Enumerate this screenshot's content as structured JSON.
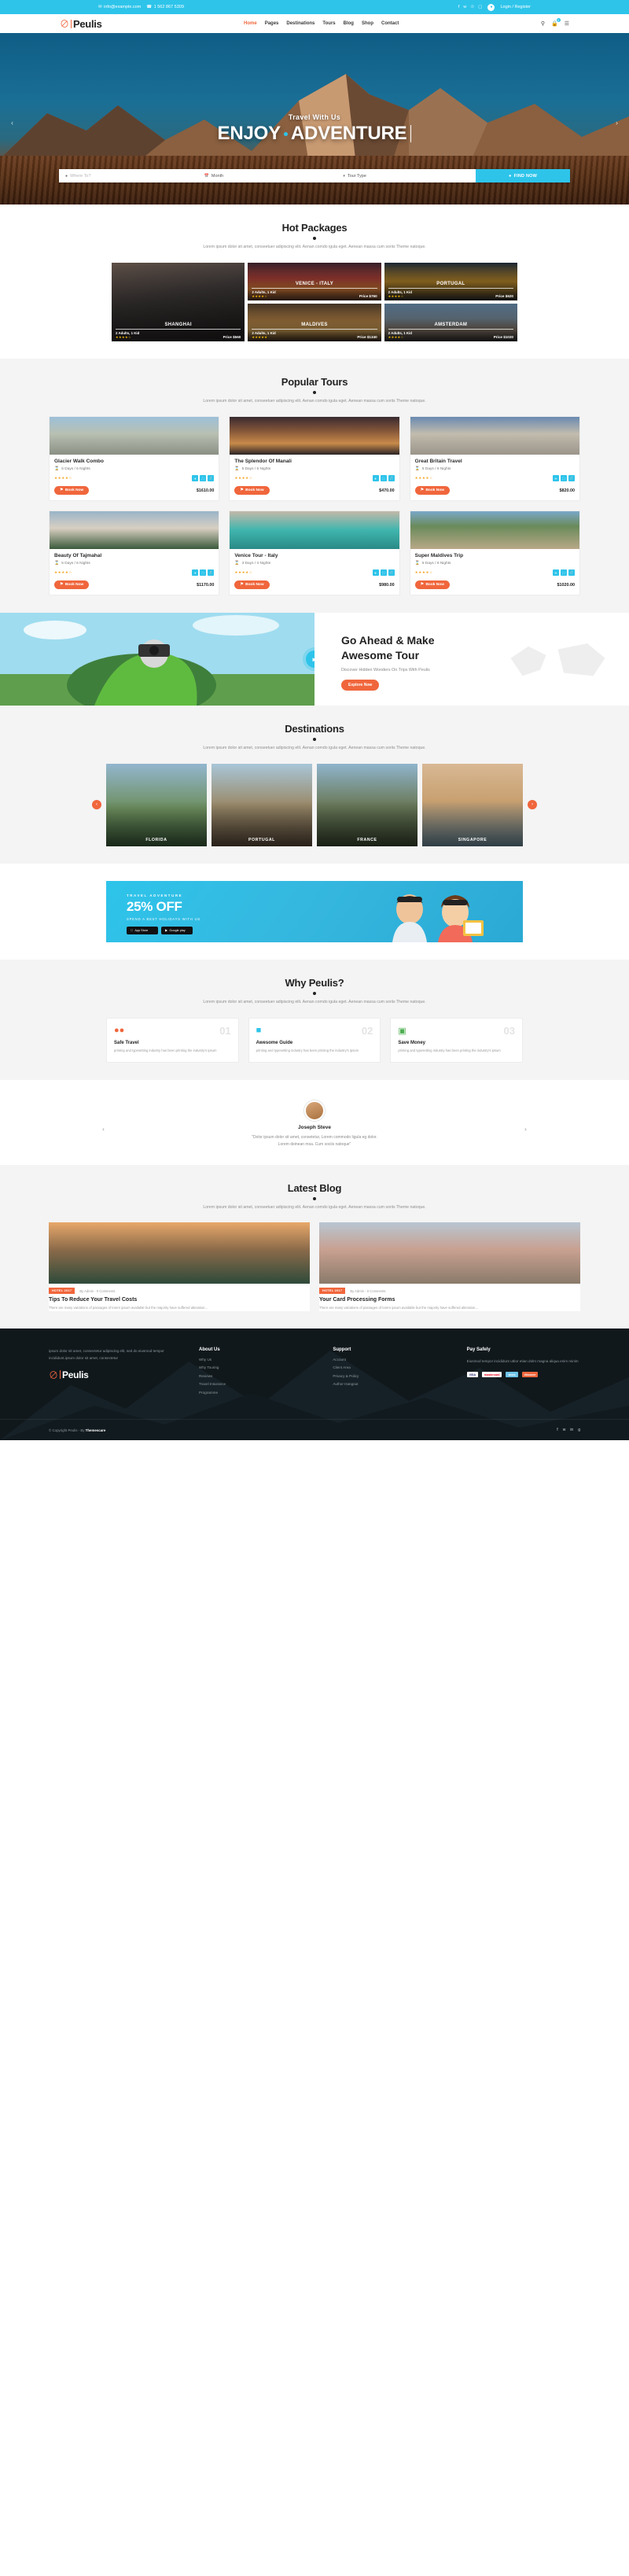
{
  "topbar": {
    "email": "info@example.com",
    "email_icon": "envelope-icon",
    "phone": "1 562 867 5309",
    "phone_icon": "phone-icon",
    "socials": [
      "facebook-icon",
      "twitter-icon",
      "pinterest-icon",
      "instagram-icon"
    ],
    "account_icon": "user-icon",
    "account_label": "Login / Register",
    "bg_color": "#2ec4ea"
  },
  "nav": {
    "brand": "Peulis",
    "brand_icon": "peulis-logo-icon",
    "items": [
      {
        "label": "Home",
        "active": true
      },
      {
        "label": "Pages",
        "active": false
      },
      {
        "label": "Destinations",
        "active": false
      },
      {
        "label": "Tours",
        "active": false
      },
      {
        "label": "Blog",
        "active": false
      },
      {
        "label": "Shop",
        "active": false
      },
      {
        "label": "Contact",
        "active": false
      }
    ],
    "search_icon": "search-icon",
    "cart_icon": "cart-icon",
    "cart_count": "0",
    "menu_icon": "hamburger-icon",
    "accent_color": "#f0663c"
  },
  "hero": {
    "subtitle": "Travel With Us",
    "title_part1": "ENJOY",
    "title_part2": "ADVENTURE",
    "prev_icon": "chevron-left-icon",
    "next_icon": "chevron-right-icon",
    "search": {
      "where_placeholder": "Where To?",
      "where_icon": "map-pin-icon",
      "month_label": "Month",
      "month_icon": "calendar-icon",
      "tourtype_label": "Tour Type",
      "tourtype_icon": "filter-icon",
      "find_label": "FIND NOW",
      "find_icon": "map-pin-icon"
    }
  },
  "hot_packages": {
    "title": "Hot Packages",
    "desc": "Lorem ipsum dolor sit amet, conseetuer adipiscing elit. Aenan comdo igula eget. Aenean massa cum soriis Theme natoque.",
    "cards": [
      {
        "name": "SHANGHAI",
        "people": "2 Adults, 1 Kid",
        "stars": 4,
        "price": "Price $560"
      },
      {
        "name": "VENICE - ITALY",
        "people": "2 Adults, 1 Kid",
        "stars": 4,
        "price": "Price $760"
      },
      {
        "name": "PORTUGAL",
        "people": "2 Adults, 1 Kid",
        "stars": 4,
        "price": "Price $620"
      },
      {
        "name": "MALDIVES",
        "people": "2 Adults, 1 Kid",
        "stars": 5,
        "price": "Price $1340"
      },
      {
        "name": "AMSTERDAM",
        "people": "2 Adults, 1 Kid",
        "stars": 4,
        "price": "Price $1020"
      }
    ]
  },
  "popular_tours": {
    "title": "Popular Tours",
    "desc": "Lorem ipsum dolor sit amet, conseetuer adipiscing elit. Aenan comdo igula eget. Aenean massa cum soriis Theme natoque.",
    "book_label": "Book Now",
    "book_icon": "flag-icon",
    "duration_icon": "hourglass-icon",
    "feature_icons": [
      "plane-icon",
      "hotel-icon",
      "restaurant-icon"
    ],
    "tours": [
      {
        "name": "Glacier Walk Combo",
        "days": "5 Days / 6 Nights",
        "stars": 4,
        "price": "$1610.00"
      },
      {
        "name": "The Splendor Of Manali",
        "days": "5 Days / 6 Nights",
        "stars": 4,
        "price": "$470.00"
      },
      {
        "name": "Great Britain Travel",
        "days": "5 Days / 6 Nights",
        "stars": 4,
        "price": "$820.00"
      },
      {
        "name": "Beauty Of Tajmahal",
        "days": "5 Days / 6 Nights",
        "stars": 4,
        "price": "$1170.00"
      },
      {
        "name": "Venice Tour - Italy",
        "days": "3 Days / 4 Nights",
        "stars": 4,
        "price": "$980.00"
      },
      {
        "name": "Super Maldives Trip",
        "days": "5 Days / 6 Nights",
        "stars": 4,
        "price": "$1020.00"
      }
    ]
  },
  "goahead": {
    "title_line1": "Go Ahead & Make",
    "title_line2": "Awesome Tour",
    "subtitle": "Discover Hidden Wonders On Trips With Peulis",
    "button": "Explore Now",
    "play_icon": "play-icon"
  },
  "destinations": {
    "title": "Destinations",
    "desc": "Lorem ipsum dolor sit amet, conseetuer adipiscing elit. Aenan comdo igula eget. Aenean massa cum soriis Theme natoque.",
    "prev_icon": "chevron-left-icon",
    "next_icon": "chevron-right-icon",
    "items": [
      {
        "name": "FLORIDA"
      },
      {
        "name": "PORTUGAL"
      },
      {
        "name": "FRANCE"
      },
      {
        "name": "SINGAPORE"
      }
    ]
  },
  "promo": {
    "kicker": "TRAVEL ADVENTURE",
    "offer": "25% OFF",
    "sub": "SPEND A BEST HOLIDAYS WITH US",
    "stores": [
      {
        "label": "App Store",
        "icon": "apple-icon"
      },
      {
        "label": "Google play",
        "icon": "google-play-icon"
      }
    ]
  },
  "why": {
    "title": "Why Peulis?",
    "desc": "Lorem ipsum dolor sit amet, conseetuer adipiscing elit. Aenan comdo igula eget. Aenean massa cum soriis Theme natoque.",
    "cards": [
      {
        "num": "01",
        "name": "Safe Travel",
        "icon": "map-pin-icon",
        "text": "printing and typesetting industry has been printing the industry's ipsum"
      },
      {
        "num": "02",
        "name": "Awesome Guide",
        "icon": "guide-icon",
        "text": "printing and typesetting industry has been printing the industry's ipsum"
      },
      {
        "num": "03",
        "name": "Save Money",
        "icon": "money-icon",
        "text": "printing and typesetting industry has been printing the industry's ipsum"
      }
    ]
  },
  "testimonial": {
    "name": "Joseph Steve",
    "quote_line1": "\"Dolor ipsum dolor sit amet, consetetur, Lorem commodo ligula eg dolor.",
    "quote_line2": "Lorem deinean msa. Cum sociis natoque\"",
    "prev_icon": "chevron-left-icon",
    "next_icon": "chevron-right-icon",
    "avatar": "avatar-image"
  },
  "blog": {
    "title": "Latest Blog",
    "desc": "Lorem ipsum dolor sit amet, conseetuer adipiscing elit. Aenan comdo igula eget. Aenean massa cum soriis Theme natoque.",
    "posts": [
      {
        "tag": "HOTEL 2017",
        "meta": "By Admin - 0 Comments",
        "title": "Tips To Reduce Your Travel Costs",
        "text": "There are many variations of passages of lorem ipsum available but the majority have suffered alteration..."
      },
      {
        "tag": "HOTEL 2017",
        "meta": "By Admin - 0 Comments",
        "title": "Your Card Processing Forms",
        "text": "There are many variations of passages of lorem ipsum available but the majority have suffered alteration..."
      }
    ]
  },
  "footer": {
    "about_text": "ipsum dolor sit amet, consectetur adipiscing elit, sed do eiusmod tempor incididunt.ipsum dolor sit amet, consectetur",
    "brand": "Peulis",
    "brand_icon": "peulis-logo-icon",
    "columns": [
      {
        "heading": "About Us",
        "links": [
          "Why Us",
          "Why Touring",
          "Reviews",
          "Travel Insurance",
          "Programme"
        ]
      },
      {
        "heading": "Support",
        "links": [
          "Account",
          "Client Area",
          "Privacy & Policy",
          "Author Hangout"
        ]
      }
    ],
    "pay": {
      "heading": "Pay Safely",
      "text": "Eiusmod tempor incididunt utbor etian dolm magna aliqua enim minim",
      "cards": [
        "VISA",
        "mastercard",
        "amex",
        "discover"
      ]
    },
    "copyright_pre": "© Copyright Peulis - By ",
    "copyright_brand": "Themescare",
    "socials": [
      "facebook-icon",
      "twitter-icon",
      "linkedin-icon",
      "google-icon"
    ]
  }
}
